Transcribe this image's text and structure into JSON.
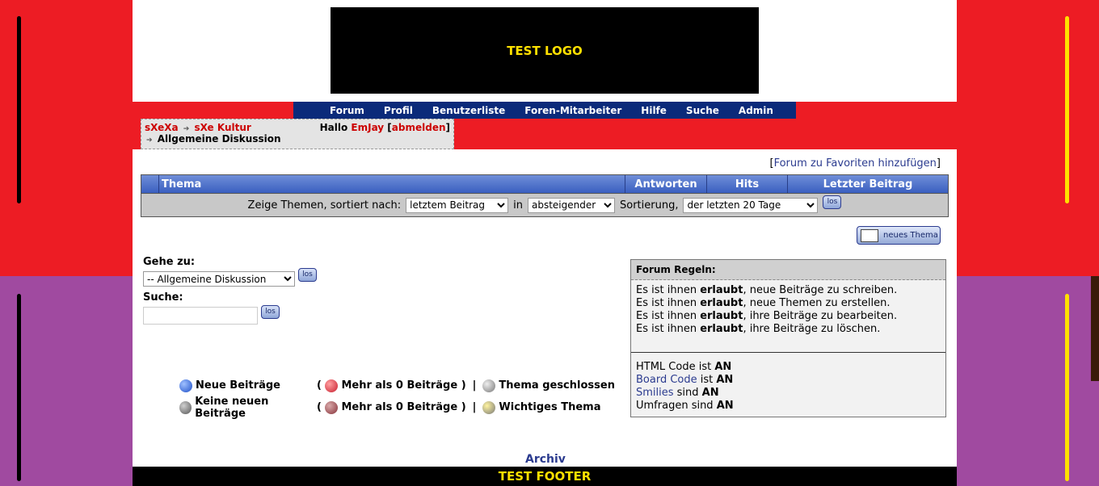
{
  "logo_text": "TEST LOGO",
  "footer_text": "TEST FOOTER",
  "nav": [
    "Forum",
    "Profil",
    "Benutzerliste",
    "Foren-Mitarbeiter",
    "Hilfe",
    "Suche",
    "Admin"
  ],
  "breadcrumb": {
    "root": "sXeXa",
    "sub": "sXe Kultur",
    "current": "Allgemeine Diskussion",
    "hello": "Hallo",
    "user": "EmJay",
    "logout": "abmelden"
  },
  "favorite_link": "Forum zu Favoriten hinzufügen",
  "table_headers": [
    "Thema",
    "Antworten",
    "Hits",
    "Letzter Beitrag"
  ],
  "sort": {
    "prefix": "Zeige Themen, sortiert nach:",
    "field_value": "letztem Beitrag",
    "in_text": "in",
    "order_value": "absteigender",
    "sortierung_text": "Sortierung,",
    "range_value": "der letzten 20 Tage",
    "go_label": "los"
  },
  "new_topic_label": "neues Thema",
  "jump": {
    "label": "Gehe zu:",
    "value": "-- Allgemeine Diskussion",
    "go_label": "los",
    "search_label": "Suche:",
    "search_go": "los"
  },
  "rules": {
    "title": "Forum Regeln:",
    "lines": [
      {
        "pre": "Es ist ihnen ",
        "bold": "erlaubt",
        "post": ", neue Beiträge zu schreiben."
      },
      {
        "pre": "Es ist ihnen ",
        "bold": "erlaubt",
        "post": ", neue Themen zu erstellen."
      },
      {
        "pre": "Es ist ihnen ",
        "bold": "erlaubt",
        "post": ", ihre Beiträge zu bearbeiten."
      },
      {
        "pre": "Es ist ihnen ",
        "bold": "erlaubt",
        "post": ", ihre Beiträge zu löschen."
      }
    ],
    "html_pre": "HTML Code ist ",
    "html_val": "AN",
    "bbcode_link": "Board Code",
    "bbcode_mid": " ist ",
    "bbcode_val": "AN",
    "smilies_link": "Smilies",
    "smilies_mid": " sind ",
    "smilies_val": "AN",
    "umfragen_pre": "Umfragen sind ",
    "umfragen_val": "AN"
  },
  "legend": {
    "new_posts": "Neue Beiträge",
    "more_than_0": "Mehr als 0 Beiträge",
    "closed": "Thema geschlossen",
    "no_new_posts": "Keine neuen Beiträge",
    "more_than_0_b": "Mehr als 0 Beiträge",
    "important": "Wichtiges Thema"
  },
  "archive_link": "Archiv",
  "colors": {
    "top_bg": "#ed1c24",
    "bottom_bg": "#a04aa0",
    "nav_bg": "#0b2a7a",
    "logo_text": "#ffe000"
  }
}
